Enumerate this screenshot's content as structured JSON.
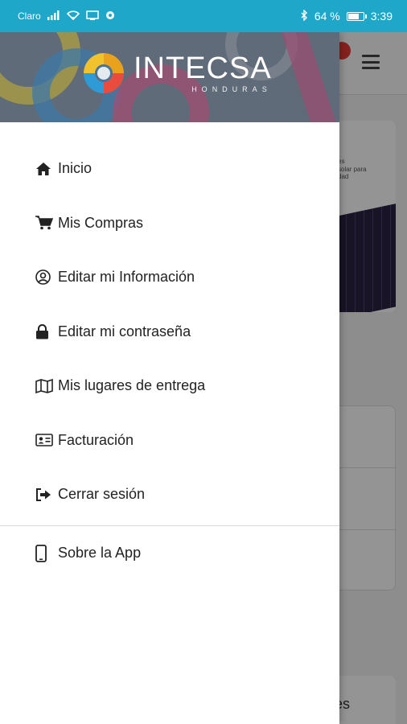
{
  "status_bar": {
    "carrier": "Claro",
    "battery_percent": "64 %",
    "battery_level": 0.64,
    "time": "3:39"
  },
  "logo": {
    "name": "INTECSA",
    "subtitle": "HONDURAS"
  },
  "drawer": {
    "items": [
      {
        "label": "Inicio",
        "icon": "home-icon"
      },
      {
        "label": "Mis Compras",
        "icon": "cart-icon"
      },
      {
        "label": "Editar mi Información",
        "icon": "user-circle-icon"
      },
      {
        "label": "Editar mi contraseña",
        "icon": "lock-icon"
      },
      {
        "label": "Mis lugares de entrega",
        "icon": "map-icon"
      },
      {
        "label": "Facturación",
        "icon": "id-card-icon"
      },
      {
        "label": "Cerrar sesión",
        "icon": "sign-out-icon"
      }
    ],
    "footer_items": [
      {
        "label": "Sobre la App",
        "icon": "mobile-icon"
      }
    ]
  },
  "background": {
    "banner_text": "es\nsolar para\ndad",
    "bottom_card_text": "es"
  },
  "colors": {
    "status_bar": "#1ea7c9",
    "accent_red": "#e53935"
  }
}
